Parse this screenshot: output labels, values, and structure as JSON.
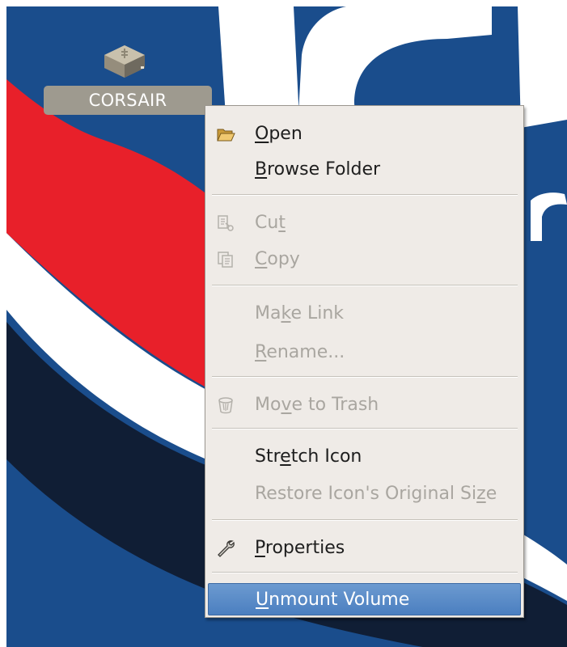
{
  "desktop": {
    "drive_label": "CORSAIR",
    "drive_icon": "usb-drive-icon",
    "colors": {
      "background": "#1a4d8c",
      "red_stripe": "#e8202a",
      "white_stripe": "#ffffff"
    }
  },
  "context_menu": {
    "items": [
      {
        "pre": "",
        "key": "O",
        "post": "pen",
        "icon": "folder-open-icon",
        "enabled": true
      },
      {
        "pre": "",
        "key": "B",
        "post": "rowse Folder",
        "enabled": true
      },
      {
        "pre": "Cu",
        "key": "t",
        "post": "",
        "icon": "cut-icon",
        "enabled": false
      },
      {
        "pre": "",
        "key": "C",
        "post": "opy",
        "icon": "copy-icon",
        "enabled": false
      },
      {
        "pre": "Ma",
        "key": "k",
        "post": "e Link",
        "enabled": false
      },
      {
        "pre": "",
        "key": "R",
        "post": "ename...",
        "enabled": false
      },
      {
        "pre": "Mo",
        "key": "v",
        "post": "e to Trash",
        "icon": "trash-icon",
        "enabled": false
      },
      {
        "pre": "Str",
        "key": "e",
        "post": "tch Icon",
        "enabled": true
      },
      {
        "pre": "Restore Icon's Original Si",
        "key": "z",
        "post": "e",
        "enabled": false
      },
      {
        "pre": "",
        "key": "P",
        "post": "roperties",
        "icon": "properties-wrench-icon",
        "enabled": true
      },
      {
        "pre": "",
        "key": "U",
        "post": "nmount Volume",
        "enabled": true,
        "selected": true
      }
    ],
    "colors": {
      "selected_bg": "#5588c8",
      "menu_bg": "#efebe7",
      "disabled_text": "#a9a6a0"
    }
  }
}
